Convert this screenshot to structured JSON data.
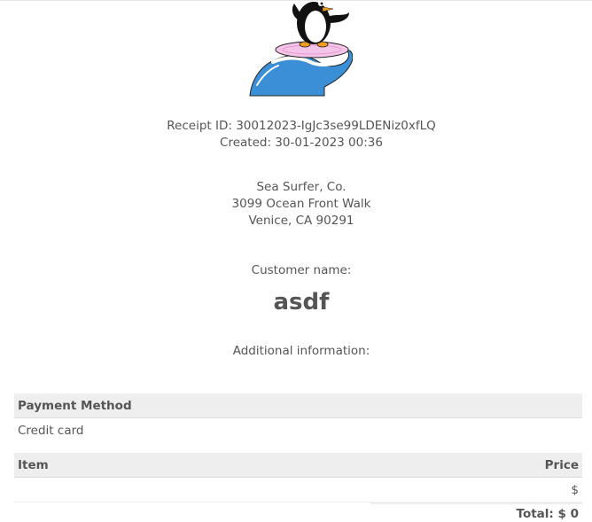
{
  "logo": {
    "icon": "penguin-surfing-wave-logo"
  },
  "receipt": {
    "id_line": "Receipt ID: 30012023-IgJc3se99LDENiz0xfLQ",
    "created_line": "Created: 30-01-2023 00:36"
  },
  "company": {
    "name": "Sea Surfer, Co.",
    "street": "3099 Ocean Front Walk",
    "city": "Venice, CA 90291"
  },
  "customer": {
    "label": "Customer name:",
    "name": "asdf"
  },
  "additional": {
    "label": "Additional information:"
  },
  "payment": {
    "header": "Payment Method",
    "method": "Credit card"
  },
  "items": {
    "header_item": "Item",
    "header_price": "Price",
    "rows": [
      {
        "item": "",
        "price": "$"
      }
    ]
  },
  "total": {
    "label": "Total: $ 0"
  },
  "colors": {
    "text": "#555555",
    "heading_bg": "#eeeeee",
    "wave": "#3b8fd6"
  }
}
